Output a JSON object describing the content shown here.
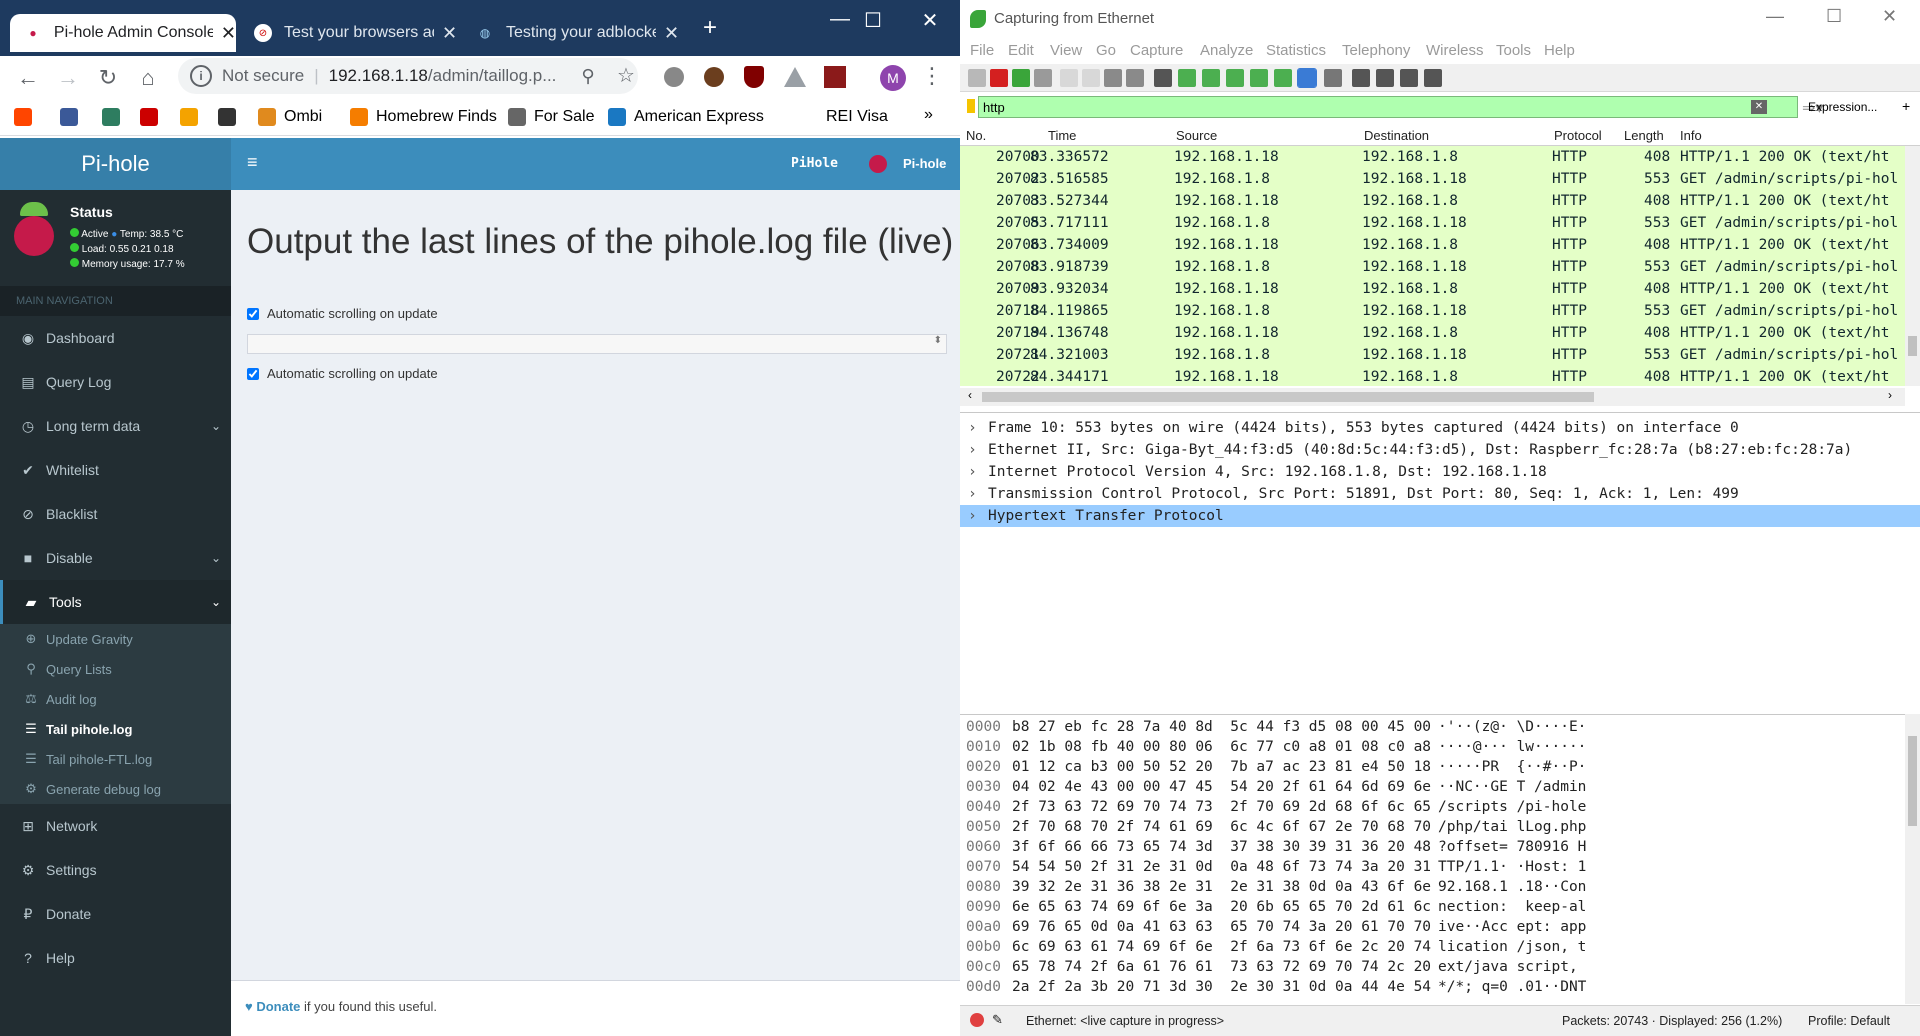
{
  "chrome": {
    "tabs": [
      {
        "title": "Pi-hole Admin Console",
        "active": true
      },
      {
        "title": "Test your browsers ad",
        "active": false
      },
      {
        "title": "Testing your adblocker",
        "active": false
      }
    ],
    "new_tab": "+",
    "window_controls": {
      "minimize": "—",
      "maximize": "☐",
      "close": "✕"
    },
    "omnibox": {
      "security": "Not secure",
      "url_host": "192.168.1.18",
      "url_path": "/admin/taillog.p..."
    },
    "bookmarks": [
      {
        "label": "",
        "color": "#ff4500"
      },
      {
        "label": "",
        "color": "#3b5998"
      },
      {
        "label": "",
        "color": "#2e7d60"
      },
      {
        "label": "",
        "color": "#cc0000"
      },
      {
        "label": "",
        "color": "#f4a300"
      },
      {
        "label": "",
        "color": "#333333"
      },
      {
        "label": "Ombi",
        "color": "#e08a1e"
      },
      {
        "label": "Homebrew Finds",
        "color": "#f57d00"
      },
      {
        "label": "For Sale",
        "color": "#666666"
      },
      {
        "label": "American Express",
        "color": "#1a78c2"
      },
      {
        "label": "REI Visa",
        "color": "#ffffff"
      }
    ],
    "bookmarks_more": "»",
    "profile_initial": "M"
  },
  "pihole": {
    "brand": "Pi-hole",
    "hostname": "PiHole",
    "user_label": "Pi-hole",
    "status": {
      "title": "Status",
      "active": "Active",
      "temp": "Temp: 38.5 °C",
      "load": "Load:  0.55  0.21  0.18",
      "memory": "Memory usage:  17.7 %"
    },
    "nav_header": "MAIN NAVIGATION",
    "menu": [
      {
        "label": "Dashboard",
        "icon": "dashboard-icon",
        "glyph": "◉"
      },
      {
        "label": "Query Log",
        "icon": "file-icon",
        "glyph": "▤"
      },
      {
        "label": "Long term data",
        "icon": "history-icon",
        "glyph": "◷"
      },
      {
        "label": "Whitelist",
        "icon": "check-circle-icon",
        "glyph": "✔"
      },
      {
        "label": "Blacklist",
        "icon": "ban-icon",
        "glyph": "⊘"
      },
      {
        "label": "Disable",
        "icon": "stop-icon",
        "glyph": "■"
      },
      {
        "label": "Tools",
        "icon": "folder-icon",
        "glyph": "▰"
      }
    ],
    "tools_submenu": [
      {
        "label": "Update Gravity",
        "glyph": "⊕"
      },
      {
        "label": "Query Lists",
        "glyph": "⚲"
      },
      {
        "label": "Audit log",
        "glyph": "⚖"
      },
      {
        "label": "Tail pihole.log",
        "glyph": "☰"
      },
      {
        "label": "Tail pihole-FTL.log",
        "glyph": "☰"
      },
      {
        "label": "Generate debug log",
        "glyph": "⚙"
      }
    ],
    "menu_after": [
      {
        "label": "Network",
        "glyph": "⊞"
      },
      {
        "label": "Settings",
        "glyph": "⚙"
      },
      {
        "label": "Donate",
        "glyph": "₽"
      },
      {
        "label": "Help",
        "glyph": "?"
      }
    ],
    "page_title": "Output the last lines of the pihole.log file (live)",
    "autoscroll_label_1": "Automatic scrolling on update",
    "autoscroll_label_2": "Automatic scrolling on update",
    "footer_donate": "Donate",
    "footer_text": " if you found this useful."
  },
  "wireshark": {
    "title": "Capturing from Ethernet",
    "menu": [
      "File",
      "Edit",
      "View",
      "Go",
      "Capture",
      "Analyze",
      "Statistics",
      "Telephony",
      "Wireless",
      "Tools",
      "Help"
    ],
    "filter": "http",
    "expression_label": "Expression...",
    "plus_label": "+",
    "columns": [
      "No.",
      "Time",
      "Source",
      "Destination",
      "Protocol",
      "Length",
      "Info"
    ],
    "packets": [
      {
        "no": "20700",
        "time": "83.336572",
        "src": "192.168.1.18",
        "dst": "192.168.1.8",
        "proto": "HTTP",
        "len": "408",
        "info": "HTTP/1.1 200 OK  (text/ht"
      },
      {
        "no": "20702",
        "time": "83.516585",
        "src": "192.168.1.8",
        "dst": "192.168.1.18",
        "proto": "HTTP",
        "len": "553",
        "info": "GET /admin/scripts/pi-hol"
      },
      {
        "no": "20703",
        "time": "83.527344",
        "src": "192.168.1.18",
        "dst": "192.168.1.8",
        "proto": "HTTP",
        "len": "408",
        "info": "HTTP/1.1 200 OK  (text/ht"
      },
      {
        "no": "20705",
        "time": "83.717111",
        "src": "192.168.1.8",
        "dst": "192.168.1.18",
        "proto": "HTTP",
        "len": "553",
        "info": "GET /admin/scripts/pi-hol"
      },
      {
        "no": "20706",
        "time": "83.734009",
        "src": "192.168.1.18",
        "dst": "192.168.1.8",
        "proto": "HTTP",
        "len": "408",
        "info": "HTTP/1.1 200 OK  (text/ht"
      },
      {
        "no": "20708",
        "time": "83.918739",
        "src": "192.168.1.8",
        "dst": "192.168.1.18",
        "proto": "HTTP",
        "len": "553",
        "info": "GET /admin/scripts/pi-hol"
      },
      {
        "no": "20709",
        "time": "83.932034",
        "src": "192.168.1.18",
        "dst": "192.168.1.8",
        "proto": "HTTP",
        "len": "408",
        "info": "HTTP/1.1 200 OK  (text/ht"
      },
      {
        "no": "20718",
        "time": "84.119865",
        "src": "192.168.1.8",
        "dst": "192.168.1.18",
        "proto": "HTTP",
        "len": "553",
        "info": "GET /admin/scripts/pi-hol"
      },
      {
        "no": "20719",
        "time": "84.136748",
        "src": "192.168.1.18",
        "dst": "192.168.1.8",
        "proto": "HTTP",
        "len": "408",
        "info": "HTTP/1.1 200 OK  (text/ht"
      },
      {
        "no": "20721",
        "time": "84.321003",
        "src": "192.168.1.8",
        "dst": "192.168.1.18",
        "proto": "HTTP",
        "len": "553",
        "info": "GET /admin/scripts/pi-hol"
      },
      {
        "no": "20722",
        "time": "84.344171",
        "src": "192.168.1.18",
        "dst": "192.168.1.8",
        "proto": "HTTP",
        "len": "408",
        "info": "HTTP/1.1 200 OK  (text/ht"
      }
    ],
    "details": [
      "Frame 10: 553 bytes on wire (4424 bits), 553 bytes captured (4424 bits) on interface 0",
      "Ethernet II, Src: Giga-Byt_44:f3:d5 (40:8d:5c:44:f3:d5), Dst: Raspberr_fc:28:7a (b8:27:eb:fc:28:7a)",
      "Internet Protocol Version 4, Src: 192.168.1.8, Dst: 192.168.1.18",
      "Transmission Control Protocol, Src Port: 51891, Dst Port: 80, Seq: 1, Ack: 1, Len: 499",
      "Hypertext Transfer Protocol"
    ],
    "hex": [
      {
        "off": "0000",
        "bytes": "b8 27 eb fc 28 7a 40 8d  5c 44 f3 d5 08 00 45 00",
        "ascii": "·'··(z@· \\D····E·"
      },
      {
        "off": "0010",
        "bytes": "02 1b 08 fb 40 00 80 06  6c 77 c0 a8 01 08 c0 a8",
        "ascii": "····@··· lw······"
      },
      {
        "off": "0020",
        "bytes": "01 12 ca b3 00 50 52 20  7b a7 ac 23 81 e4 50 18",
        "ascii": "·····PR  {··#··P·"
      },
      {
        "off": "0030",
        "bytes": "04 02 4e 43 00 00 47 45  54 20 2f 61 64 6d 69 6e",
        "ascii": "··NC··GE T /admin"
      },
      {
        "off": "0040",
        "bytes": "2f 73 63 72 69 70 74 73  2f 70 69 2d 68 6f 6c 65",
        "ascii": "/scripts /pi-hole"
      },
      {
        "off": "0050",
        "bytes": "2f 70 68 70 2f 74 61 69  6c 4c 6f 67 2e 70 68 70",
        "ascii": "/php/tai lLog.php"
      },
      {
        "off": "0060",
        "bytes": "3f 6f 66 66 73 65 74 3d  37 38 30 39 31 36 20 48",
        "ascii": "?offset= 780916 H"
      },
      {
        "off": "0070",
        "bytes": "54 54 50 2f 31 2e 31 0d  0a 48 6f 73 74 3a 20 31",
        "ascii": "TTP/1.1· ·Host: 1"
      },
      {
        "off": "0080",
        "bytes": "39 32 2e 31 36 38 2e 31  2e 31 38 0d 0a 43 6f 6e",
        "ascii": "92.168.1 .18··Con"
      },
      {
        "off": "0090",
        "bytes": "6e 65 63 74 69 6f 6e 3a  20 6b 65 65 70 2d 61 6c",
        "ascii": "nection:  keep-al"
      },
      {
        "off": "00a0",
        "bytes": "69 76 65 0d 0a 41 63 63  65 70 74 3a 20 61 70 70",
        "ascii": "ive··Acc ept: app"
      },
      {
        "off": "00b0",
        "bytes": "6c 69 63 61 74 69 6f 6e  2f 6a 73 6f 6e 2c 20 74",
        "ascii": "lication /json, t"
      },
      {
        "off": "00c0",
        "bytes": "65 78 74 2f 6a 61 76 61  73 63 72 69 70 74 2c 20",
        "ascii": "ext/java script, "
      },
      {
        "off": "00d0",
        "bytes": "2a 2f 2a 3b 20 71 3d 30  2e 30 31 0d 0a 44 4e 54",
        "ascii": "*/*; q=0 .01··DNT"
      }
    ],
    "status": {
      "interface": "Ethernet: <live capture in progress>",
      "packets": "Packets: 20743 · Displayed: 256 (1.2%)",
      "profile": "Profile: Default"
    }
  }
}
